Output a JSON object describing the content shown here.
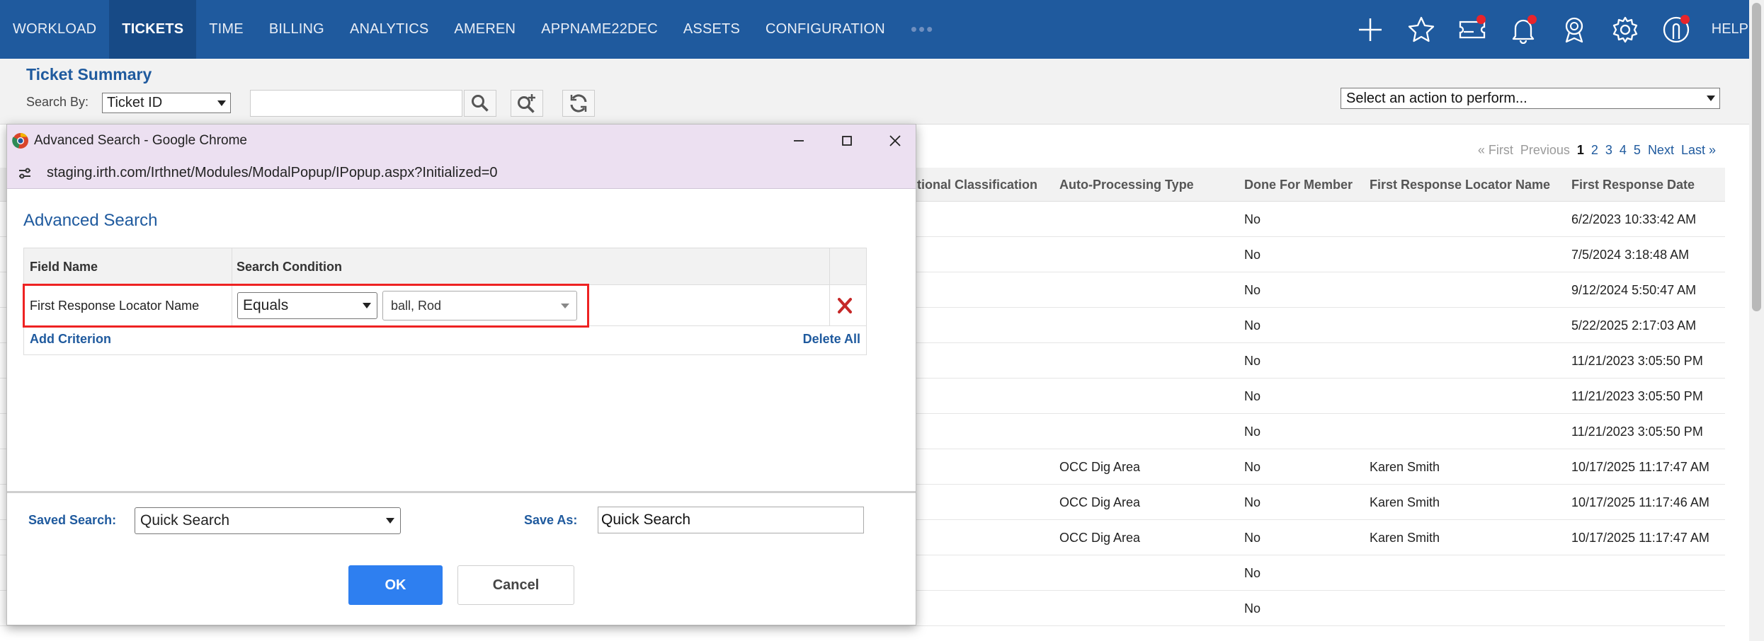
{
  "nav": {
    "items": [
      {
        "label": "WORKLOAD",
        "active": false
      },
      {
        "label": "TICKETS",
        "active": true
      },
      {
        "label": "TIME",
        "active": false
      },
      {
        "label": "BILLING",
        "active": false
      },
      {
        "label": "ANALYTICS",
        "active": false
      },
      {
        "label": "AMEREN",
        "active": false
      },
      {
        "label": "APPNAME22DEC",
        "active": false
      },
      {
        "label": "ASSETS",
        "active": false
      },
      {
        "label": "CONFIGURATION",
        "active": false
      }
    ],
    "more": "•••",
    "icons": [
      "plus-icon",
      "star-icon",
      "ticket-icon",
      "bell-icon",
      "award-icon",
      "gear-icon",
      "user-icon"
    ],
    "help": "HELP",
    "colors": {
      "bar": "#1f5a9e",
      "active": "#174a86",
      "badge": "#e8242b"
    }
  },
  "page": {
    "title": "Ticket Summary",
    "search_by_label": "Search By:",
    "search_by_value": "Ticket ID",
    "search_placeholder": "",
    "action_select": "Select an action to perform..."
  },
  "pager": {
    "first": "« First",
    "previous": "Previous",
    "pages": [
      "1",
      "2",
      "3",
      "4",
      "5"
    ],
    "current": "1",
    "next": "Next",
    "last": "Last »"
  },
  "grid": {
    "columns": [
      "itional Classification",
      "Auto-Processing Type",
      "Done For Member",
      "First Response Locator Name",
      "First Response Date"
    ],
    "rows": [
      [
        "",
        "",
        "No",
        "",
        "6/2/2023 10:33:42 AM"
      ],
      [
        "",
        "",
        "No",
        "",
        "7/5/2024 3:18:48 AM"
      ],
      [
        "",
        "",
        "No",
        "",
        "9/12/2024 5:50:47 AM"
      ],
      [
        "",
        "",
        "No",
        "",
        "5/22/2025 2:17:03 AM"
      ],
      [
        "",
        "",
        "No",
        "",
        "11/21/2023 3:05:50 PM"
      ],
      [
        "",
        "",
        "No",
        "",
        "11/21/2023 3:05:50 PM"
      ],
      [
        "",
        "",
        "No",
        "",
        "11/21/2023 3:05:50 PM"
      ],
      [
        "",
        "OCC Dig Area",
        "No",
        "Karen Smith",
        "10/17/2025 11:17:47 AM"
      ],
      [
        "",
        "OCC Dig Area",
        "No",
        "Karen Smith",
        "10/17/2025 11:17:46 AM"
      ],
      [
        "",
        "OCC Dig Area",
        "No",
        "Karen Smith",
        "10/17/2025 11:17:47 AM"
      ],
      [
        "",
        "",
        "No",
        "",
        ""
      ],
      [
        "",
        "",
        "No",
        "",
        ""
      ]
    ]
  },
  "modal": {
    "window_title": "Advanced Search - Google Chrome",
    "url": "staging.irth.com/Irthnet/Modules/ModalPopup/IPopup.aspx?Initialized=0",
    "heading": "Advanced Search",
    "table": {
      "col_field": "Field Name",
      "col_condition": "Search Condition",
      "criteria": [
        {
          "field": "First Response Locator Name",
          "condition": "Equals",
          "value": "ball, Rod"
        }
      ],
      "add_criterion": "Add Criterion",
      "delete_all": "Delete All"
    },
    "saved_search_label": "Saved Search:",
    "saved_search_value": "Quick Search",
    "save_as_label": "Save As:",
    "save_as_value": "Quick Search",
    "ok": "OK",
    "cancel": "Cancel",
    "colors": {
      "titlebar": "#ece0f1",
      "highlight": "#e22222",
      "ok": "#2e7ff0"
    }
  }
}
